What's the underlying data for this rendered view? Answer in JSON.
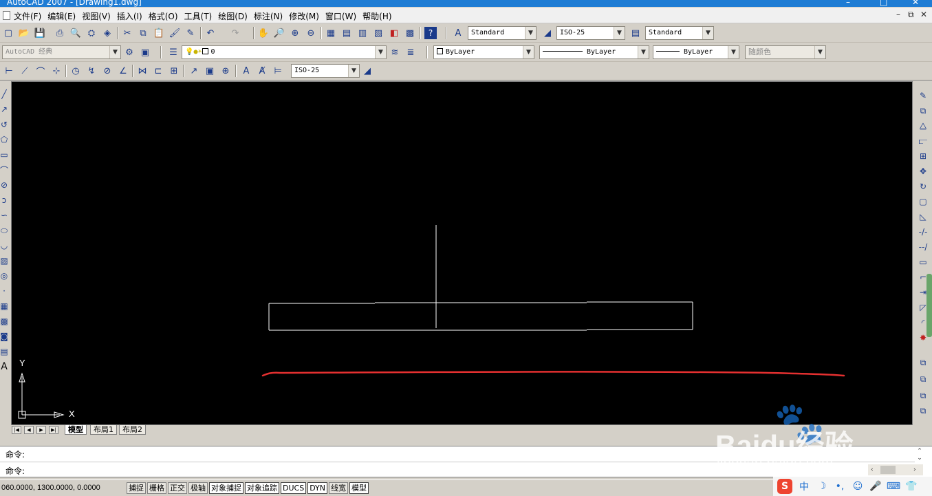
{
  "window": {
    "title": "AutoCAD 2007 - [Drawing1.dwg]",
    "controls": [
      "–",
      "□",
      "✕"
    ]
  },
  "menubar": {
    "items": [
      "文件(F)",
      "编辑(E)",
      "视图(V)",
      "插入(I)",
      "格式(O)",
      "工具(T)",
      "绘图(D)",
      "标注(N)",
      "修改(M)",
      "窗口(W)",
      "帮助(H)"
    ],
    "doc_controls": [
      "–",
      "⧉",
      "✕"
    ]
  },
  "standard_toolbar": {
    "text_style": "Standard",
    "dim_style": "ISO-25",
    "table_style": "Standard"
  },
  "layers_toolbar": {
    "workspace": "AutoCAD 经典",
    "current_layer": "0",
    "color": "ByLayer",
    "linetype": "ByLayer",
    "lineweight": "ByLayer",
    "plot_style": "随颜色"
  },
  "dimension_toolbar": {
    "dim_style": "ISO-25"
  },
  "canvas": {
    "ucs_y": "Y",
    "ucs_x": "X",
    "entity_color": "#ffffff",
    "annotation_color": "#e53030"
  },
  "layout_tabs": {
    "nav": [
      "|◀",
      "◀",
      "▶",
      "▶|"
    ],
    "tabs": [
      "模型",
      "布局1",
      "布局2"
    ]
  },
  "command": {
    "line1": "命令:",
    "line2": "命令:"
  },
  "status": {
    "coords": "060.0000, 1300.0000, 0.0000",
    "toggles": [
      "捕捉",
      "栅格",
      "正交",
      "极轴",
      "对象捕捉",
      "对象追踪",
      "DUCS",
      "DYN",
      "线宽",
      "模型"
    ]
  },
  "ime": {
    "logo": "S",
    "lang": "中"
  },
  "watermark": {
    "brand": "Baidu经验",
    "url": "jingyan.baidu.com"
  }
}
